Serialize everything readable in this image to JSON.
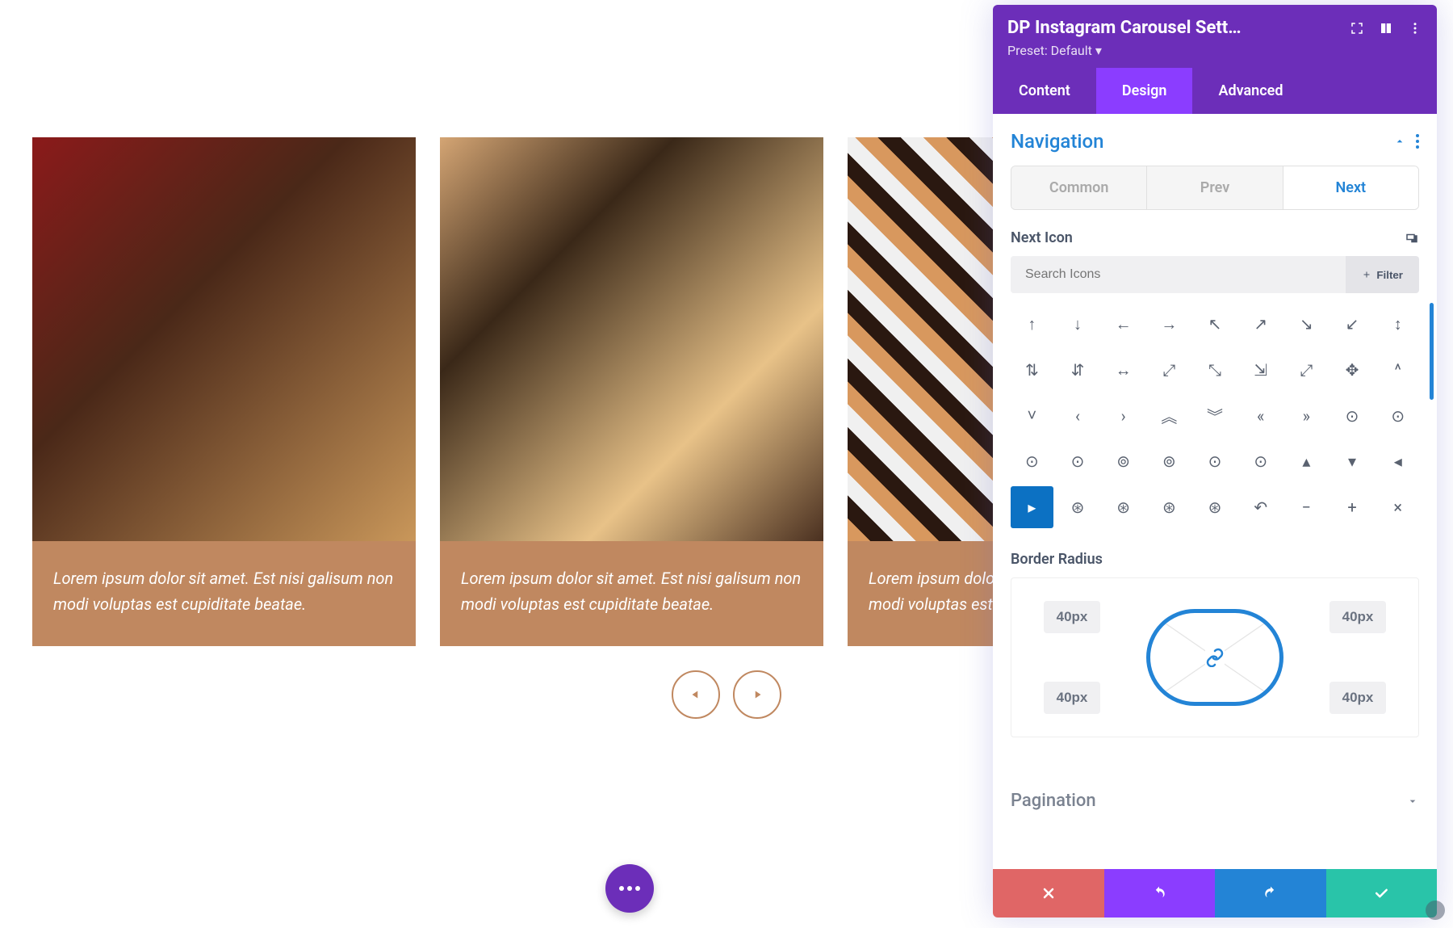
{
  "carousel": {
    "items": [
      {
        "caption": "Lorem ipsum dolor sit amet. Est nisi galisum non modi voluptas est cupiditate beatae."
      },
      {
        "caption": "Lorem ipsum dolor sit amet. Est nisi galisum non modi voluptas est cupiditate beatae."
      },
      {
        "caption": "Lorem ipsum dolor sit amet. Est nisi galisum non modi voluptas est cupiditate beatae."
      }
    ]
  },
  "panel": {
    "title": "DP Instagram Carousel Sett…",
    "preset_label": "Preset: Default",
    "tabs": {
      "content": "Content",
      "design": "Design",
      "advanced": "Advanced"
    },
    "section_navigation": "Navigation",
    "subtabs": {
      "common": "Common",
      "prev": "Prev",
      "next": "Next"
    },
    "next_icon_label": "Next Icon",
    "search_placeholder": "Search Icons",
    "filter_label": "Filter",
    "icons": [
      "↑",
      "↓",
      "←",
      "→",
      "↖",
      "↗",
      "↘",
      "↙",
      "↕",
      "⇅",
      "⇵",
      "↔",
      "⤢",
      "⤡",
      "⇲",
      "⤢",
      "✥",
      "^",
      "˅",
      "‹",
      "›",
      "︽",
      "︾",
      "«",
      "»",
      "⊙",
      "⊙",
      "⊙",
      "⊙",
      "⊚",
      "⊚",
      "⊙",
      "⊙",
      "▴",
      "▾",
      "◂",
      "▸",
      "⊛",
      "⊛",
      "⊛",
      "⊛",
      "↶",
      "−",
      "+",
      "×"
    ],
    "selected_icon_index": 36,
    "border_radius_label": "Border Radius",
    "border_radius": {
      "tl": "40px",
      "tr": "40px",
      "bl": "40px",
      "br": "40px"
    },
    "pagination_label": "Pagination"
  }
}
